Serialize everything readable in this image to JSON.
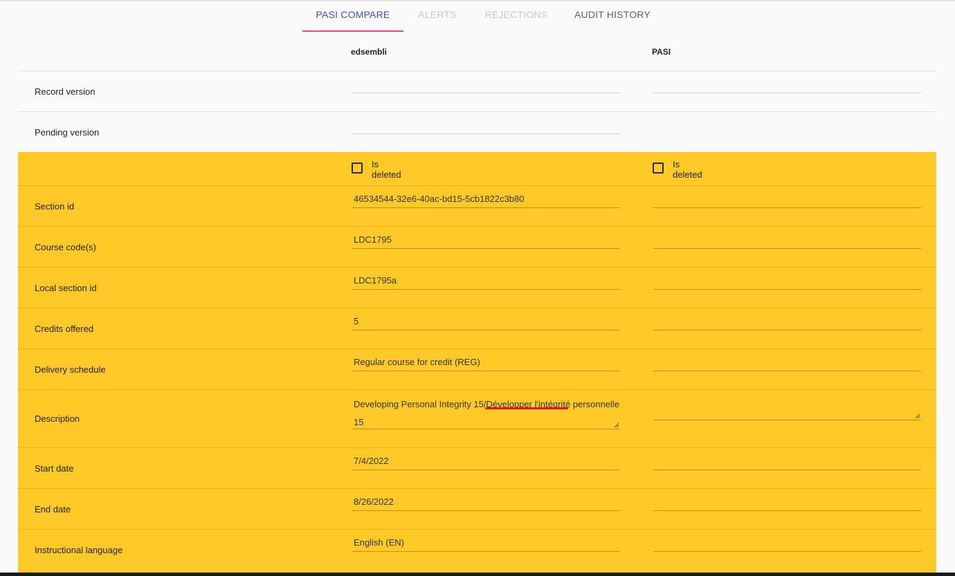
{
  "tabs": [
    {
      "label": "PASI COMPARE",
      "state": "active"
    },
    {
      "label": "ALERTS",
      "state": "disabled"
    },
    {
      "label": "REJECTIONS",
      "state": "disabled"
    },
    {
      "label": "AUDIT HISTORY",
      "state": "normal"
    }
  ],
  "columns": {
    "left": "edsembli",
    "right": "PASI"
  },
  "rows": {
    "record_version": {
      "label": "Record version",
      "left": "",
      "right": ""
    },
    "pending_version": {
      "label": "Pending version",
      "left": ""
    },
    "is_deleted": {
      "left_label": "Is\ndeleted",
      "right_label": "Is\ndeleted",
      "left_checked": false,
      "right_checked": false
    },
    "section_id": {
      "label": "Section id",
      "left": "46534544-32e6-40ac-bd15-5cb1822c3b80",
      "right": ""
    },
    "course_codes": {
      "label": "Course code(s)",
      "left": "LDC1795",
      "right": ""
    },
    "local_section_id": {
      "label": "Local section id",
      "left": "LDC1795a",
      "right": ""
    },
    "credits_offered": {
      "label": "Credits offered",
      "left": "5",
      "right": ""
    },
    "delivery_schedule": {
      "label": "Delivery schedule",
      "left": "Regular course for credit (REG)",
      "right": ""
    },
    "description": {
      "label": "Description",
      "left": "Developing Personal Integrity 15/Développer l'intégrité personnelle 15",
      "right": ""
    },
    "start_date": {
      "label": "Start date",
      "left": "7/4/2022",
      "right": ""
    },
    "end_date": {
      "label": "End date",
      "left": "8/26/2022",
      "right": ""
    },
    "instructional_language": {
      "label": "Instructional language",
      "left": "English (EN)",
      "right": ""
    }
  },
  "colors": {
    "highlight": "#ffca28",
    "tab_active": "#3f51b5",
    "tab_ink": "#ff4081",
    "spell_underline": "#e01b1b"
  }
}
